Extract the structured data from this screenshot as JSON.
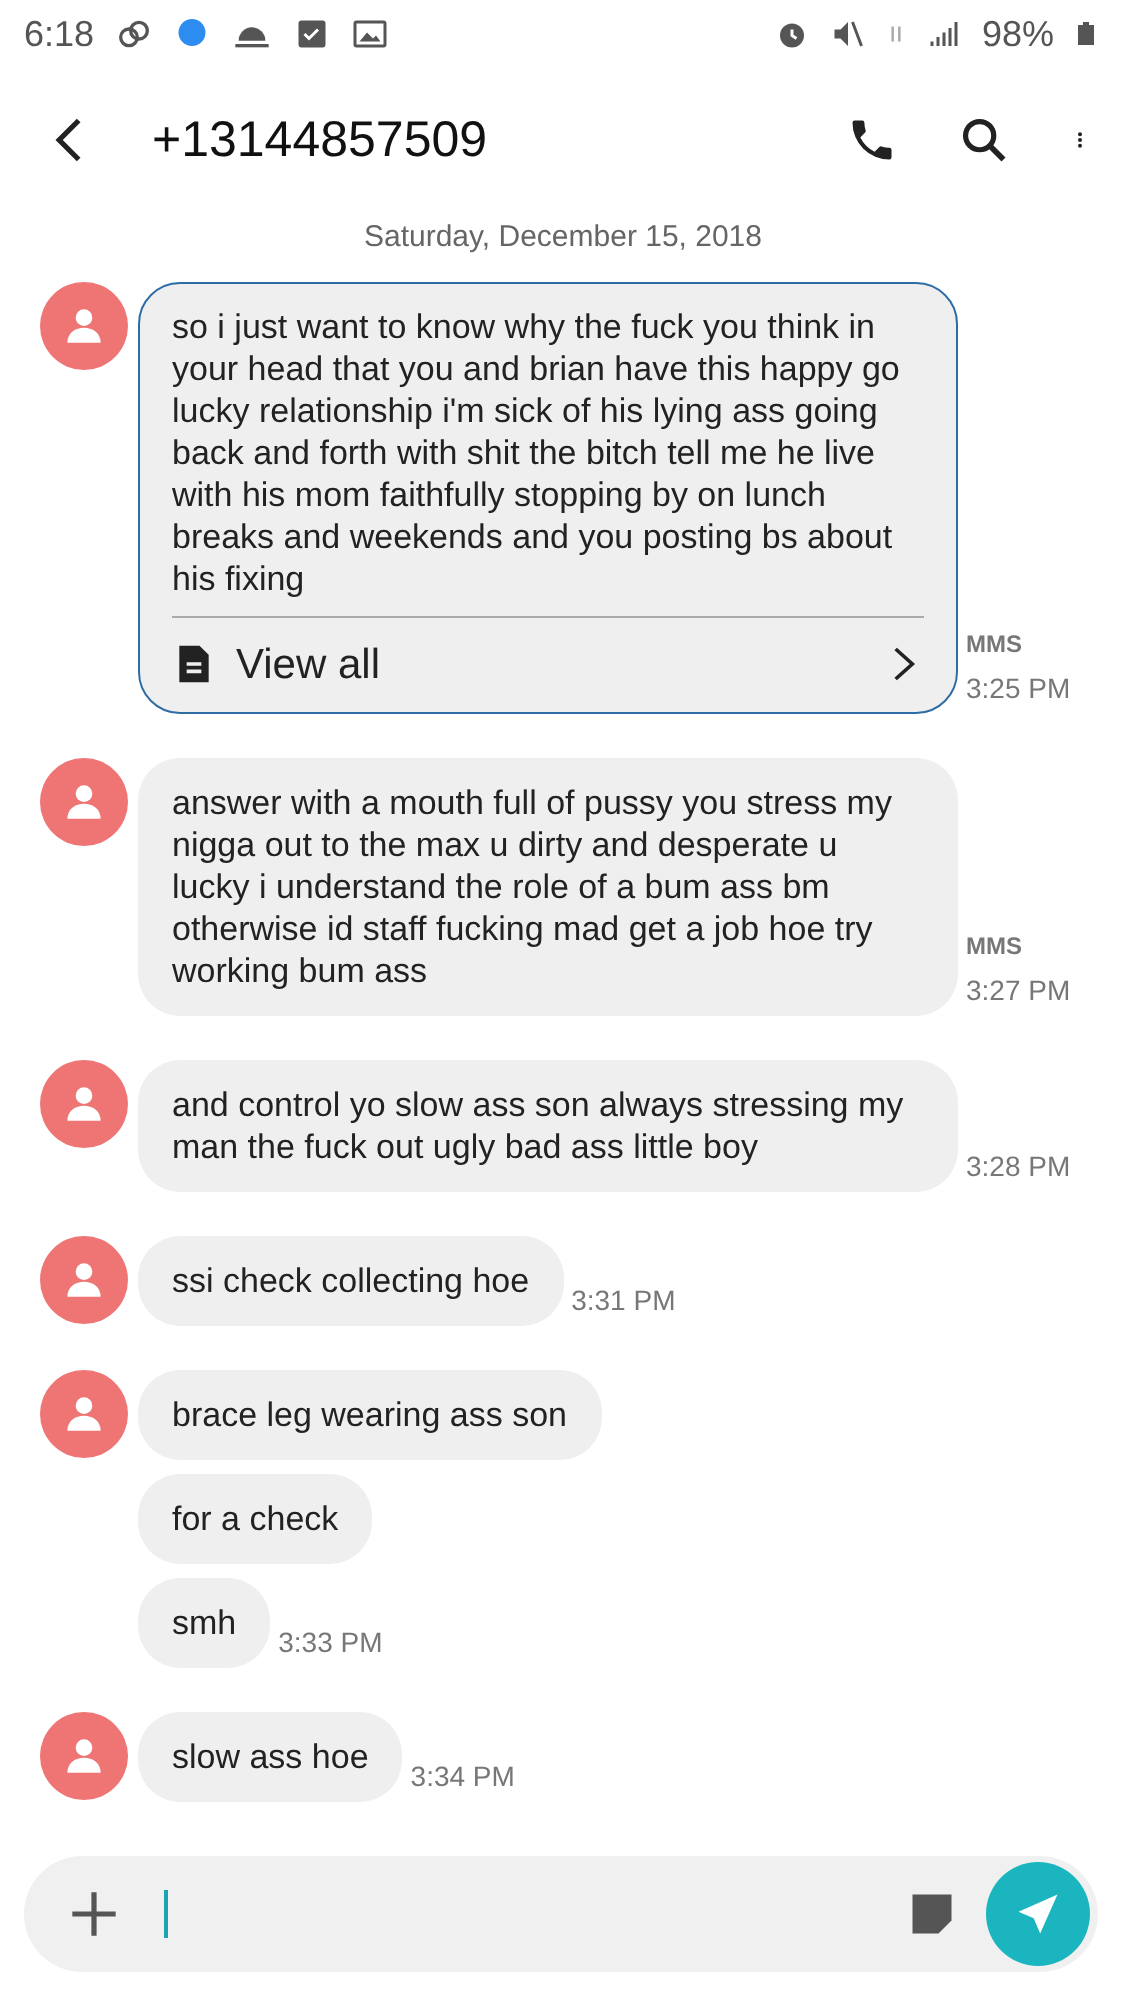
{
  "status_bar": {
    "time": "6:18",
    "battery": "98%"
  },
  "header": {
    "title": "+13144857509"
  },
  "date": "Saturday, December 15, 2018",
  "messages": [
    {
      "avatar": true,
      "selected": true,
      "text": "so i just want to know why the fuck you think in your head that you and brian have this happy go lucky relationship i'm sick of his lying ass going back and forth with shit the bitch tell me he live with his mom faithfully stopping by on lunch breaks and weekends and you posting bs about his fixing",
      "view_all": "View all",
      "type": "MMS",
      "time": "3:25 PM"
    },
    {
      "avatar": true,
      "selected": false,
      "text": "answer with a mouth full of pussy you stress my nigga out to the max u dirty and desperate u lucky i understand the role of a bum ass bm otherwise id staff fucking mad get a job hoe try working bum ass",
      "type": "MMS",
      "time": "3:27 PM"
    },
    {
      "avatar": true,
      "selected": false,
      "text": "and control yo slow ass son always stressing my man the fuck out ugly bad ass little boy",
      "time": "3:28 PM"
    },
    {
      "avatar": true,
      "selected": false,
      "text": "ssi check collecting hoe",
      "time": "3:31 PM"
    },
    {
      "avatar": true,
      "selected": false,
      "text": "brace leg wearing ass son"
    },
    {
      "avatar": false,
      "selected": false,
      "text": "for a check"
    },
    {
      "avatar": false,
      "selected": false,
      "text": "smh",
      "time": "3:33 PM"
    },
    {
      "avatar": true,
      "selected": false,
      "text": "slow ass hoe",
      "time": "3:34 PM"
    }
  ]
}
